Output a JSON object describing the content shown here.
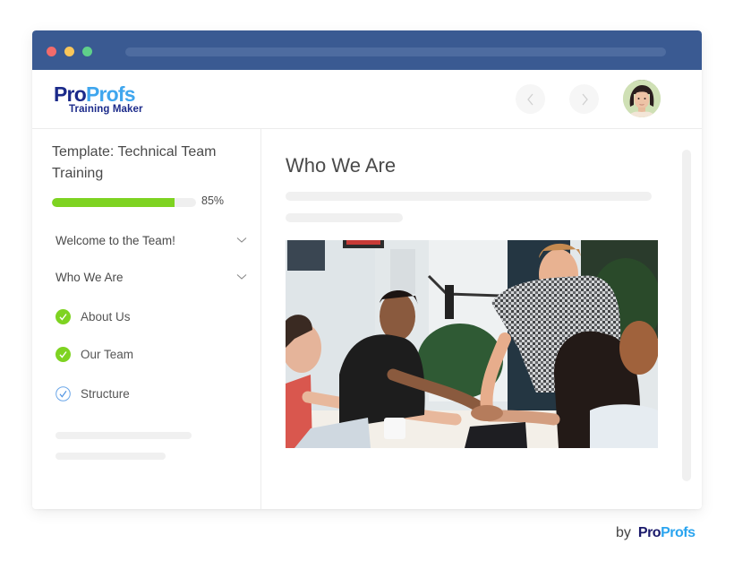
{
  "browser": {
    "window_controls": [
      "close",
      "minimize",
      "maximize"
    ]
  },
  "header": {
    "logo": {
      "part1": "Pro",
      "part2": "Profs",
      "subtitle": "Training Maker"
    },
    "prev_icon": "chevron-left-icon",
    "next_icon": "chevron-right-icon",
    "avatar_icon": "user-avatar"
  },
  "sidebar": {
    "course_title": "Template: Technical Team Training",
    "progress": {
      "percent": 85,
      "label": "85%"
    },
    "sections": [
      {
        "label": "Welcome to the Team!",
        "icon": "chevron-down-icon"
      },
      {
        "label": "Who We Are",
        "icon": "chevron-down-icon"
      }
    ],
    "lessons": [
      {
        "label": "About Us",
        "status": "completed",
        "icon": "check-circle-filled-icon"
      },
      {
        "label": "Our Team",
        "status": "completed",
        "icon": "check-circle-filled-icon"
      },
      {
        "label": "Structure",
        "status": "current",
        "icon": "check-circle-outline-icon"
      }
    ]
  },
  "main": {
    "title": "Who We Are",
    "image_alt": "Team members stacking hands together over a table"
  },
  "footer": {
    "by": "by",
    "brand_part1": "Pro",
    "brand_part2": "Profs"
  },
  "colors": {
    "titlebar": "#3a5a92",
    "progress": "#7ed321",
    "check_filled": "#7ed321",
    "check_outline": "#4a90e2",
    "brand_dark": "#1b2a8a",
    "brand_light": "#3fa6ee"
  }
}
